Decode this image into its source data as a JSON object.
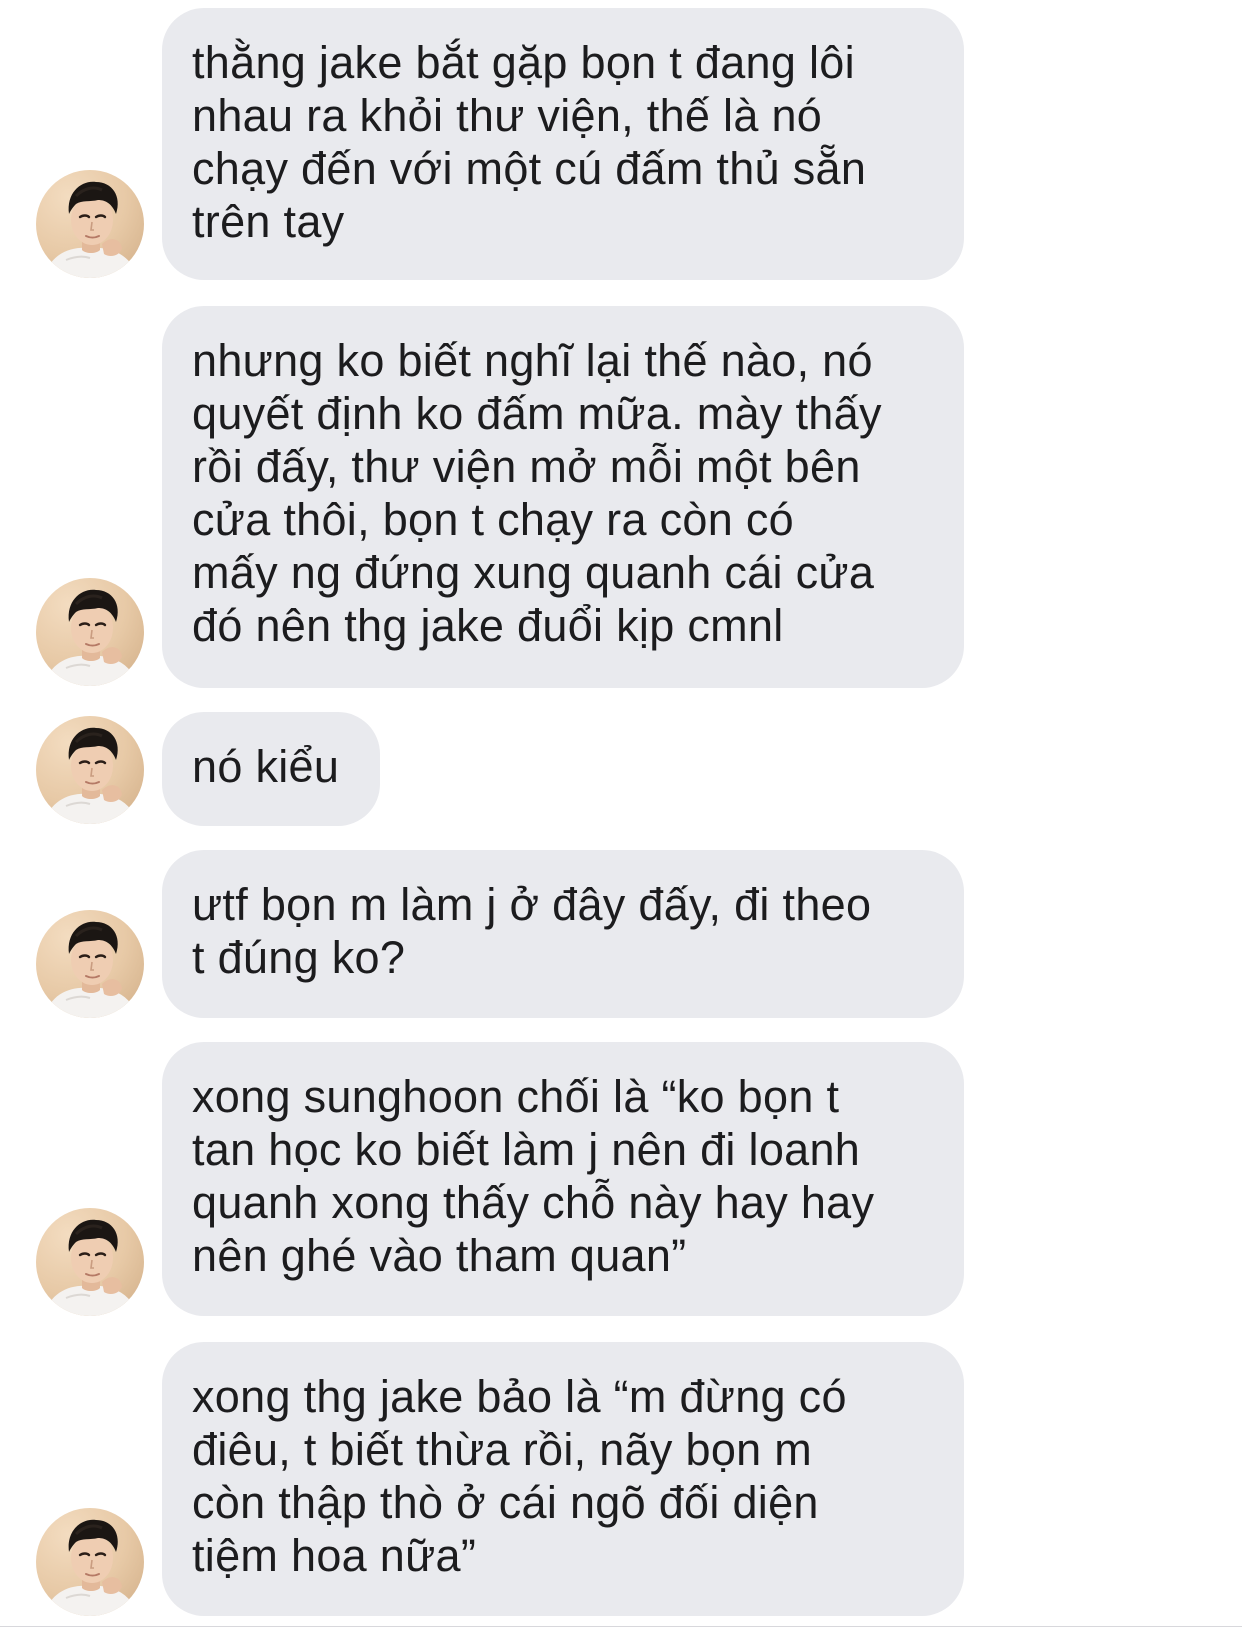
{
  "conversation": {
    "messages": [
      {
        "text": "thằng jake bắt gặp bọn t đang lôi\nnhau ra khỏi thư viện, thế là nó\nchạy đến với một cú đấm thủ sẵn\ntrên tay",
        "avatar_icon": "user-photo-avatar"
      },
      {
        "text": "nhưng ko biết nghĩ lại thế nào, nó\nquyết định ko đấm mữa. mày thấy\nrồi đấy, thư viện mở mỗi một bên\ncửa thôi, bọn t chạy ra còn có\nmấy ng đứng xung quanh cái cửa\nđó nên thg jake đuổi kịp cmnl",
        "avatar_icon": "user-photo-avatar"
      },
      {
        "text": "nó kiểu",
        "avatar_icon": "user-photo-avatar"
      },
      {
        "text": "ưtf bọn m làm j ở đây đấy, đi theo\nt đúng ko?",
        "avatar_icon": "user-photo-avatar"
      },
      {
        "text": "xong sunghoon chối là “ko bọn t\ntan học ko biết làm j nên đi loanh\nquanh xong thấy chỗ này hay hay\nnên ghé vào tham quan”",
        "avatar_icon": "user-photo-avatar"
      },
      {
        "text": "xong thg jake bảo là “m đừng có\nđiêu, t biết thừa rồi, nãy bọn m\ncòn thập thò ở cái ngõ đối diện\ntiệm hoa nữa”",
        "avatar_icon": "user-photo-avatar"
      }
    ]
  },
  "colors": {
    "bubble_bg": "#e9eaee",
    "text": "#1c1c1e",
    "page_bg": "#ffffff"
  }
}
